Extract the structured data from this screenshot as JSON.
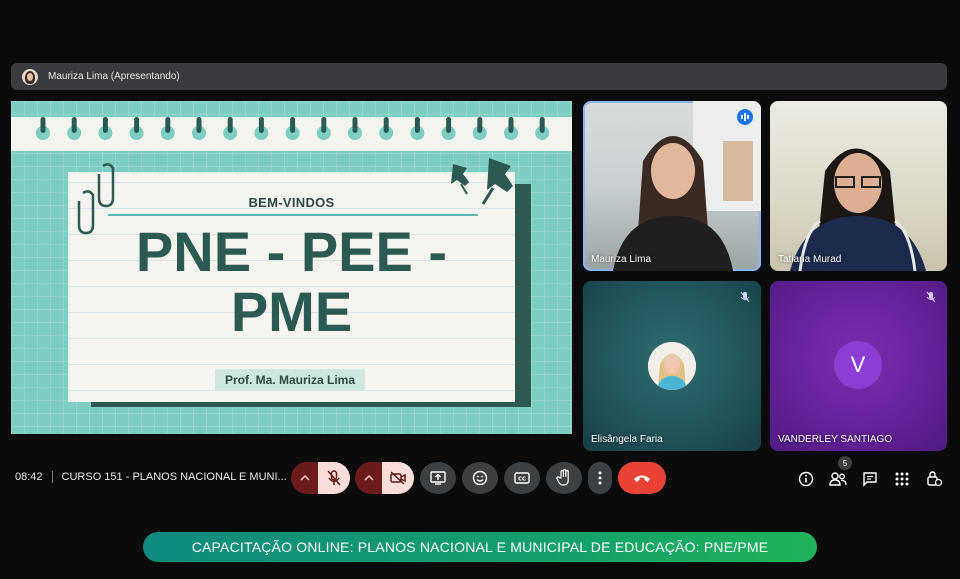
{
  "presenter_bar": {
    "label": "Mauriza Lima (Apresentando)"
  },
  "slide": {
    "welcome": "BEM-VINDOS",
    "title_line1": "PNE - PEE -",
    "title_line2": "PME",
    "author": "Prof. Ma. Mauriza Lima"
  },
  "participants": [
    {
      "name": "Mauriza Lima",
      "mic": "speaking"
    },
    {
      "name": "Tatiana Murad",
      "mic": "on"
    },
    {
      "name": "Elisângela Faria",
      "mic": "muted"
    },
    {
      "name": "VANDERLEY SANTIAGO",
      "mic": "muted",
      "initial": "V"
    }
  ],
  "controls": {
    "time": "08:42",
    "meeting_title": "CURSO 151 - PLANOS NACIONAL E MUNI...",
    "people_count": "5"
  },
  "banner": {
    "text": "CAPACITAÇÃO ONLINE: PLANOS NACIONAL E MUNICIPAL DE EDUCAÇÃO: PNE/PME"
  },
  "colors": {
    "accent": "#8ab4f8",
    "end_call": "#ea4335",
    "muted_bg": "#f9dedc",
    "slide_teal": "#7dcdc3"
  }
}
